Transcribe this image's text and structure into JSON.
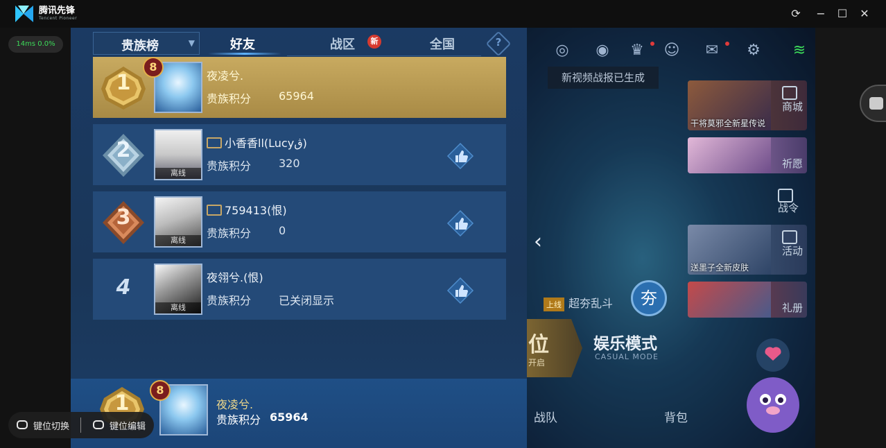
{
  "emulator": {
    "app_name": "腾讯先锋",
    "app_subtitle": "Tencent Pioneer",
    "fps_text": "14ms 0.0%",
    "window_controls": [
      "refresh-icon",
      "minimize-icon",
      "maximize-icon",
      "close-icon"
    ],
    "keymap": {
      "switch_label": "键位切换",
      "edit_label": "键位编辑"
    }
  },
  "panel": {
    "dropdown_label": "贵族榜",
    "tabs": [
      {
        "label": "好友",
        "active": true
      },
      {
        "label": "战区",
        "badge": "新"
      },
      {
        "label": "全国"
      }
    ],
    "help": "?",
    "score_label": "贵族积分",
    "rows": [
      {
        "rank": "1",
        "name": "夜凌兮.",
        "level": "8",
        "score": "65964",
        "offline": "",
        "highlight": true
      },
      {
        "rank": "2",
        "name": "小香香ll(Lucyڨ)",
        "score": "320",
        "offline": "离线",
        "noble": true
      },
      {
        "rank": "3",
        "name": "759413(恨)",
        "score": "0",
        "offline": "离线",
        "noble": true
      },
      {
        "rank": "4",
        "name": "夜翎兮.(恨)",
        "score": "已关闭显示",
        "offline": "离线"
      }
    ],
    "self": {
      "rank": "1",
      "level": "8",
      "name": "夜凌兮.",
      "score_label": "贵族积分",
      "score": "65964"
    }
  },
  "scene": {
    "toast": "新视频战报已生成",
    "promos": [
      {
        "caption": "干将莫邪全新星传说",
        "label": "商城"
      },
      {
        "caption": "",
        "label": "祈愿"
      },
      {
        "caption": "",
        "label": "战令"
      },
      {
        "caption": "送墨子全新皮肤",
        "label": "活动"
      },
      {
        "caption": "",
        "label": "礼册"
      }
    ],
    "mode_tag": "上线",
    "mode_name": "超夯乱斗",
    "mode_badge": "夯",
    "casual_title": "娱乐模式",
    "casual_sub": "CASUAL MODE",
    "rank_text": "位",
    "rank_sub": "开启",
    "nav": [
      "战队",
      "背包"
    ]
  },
  "colors": {
    "panel_bg": "#1b3a63",
    "row_bg": "#244a78",
    "first_row_gold": "#c8aa60",
    "accent_gold": "#f0d98a",
    "new_badge": "#d63a2f",
    "fps_green": "#3ddc5a"
  }
}
